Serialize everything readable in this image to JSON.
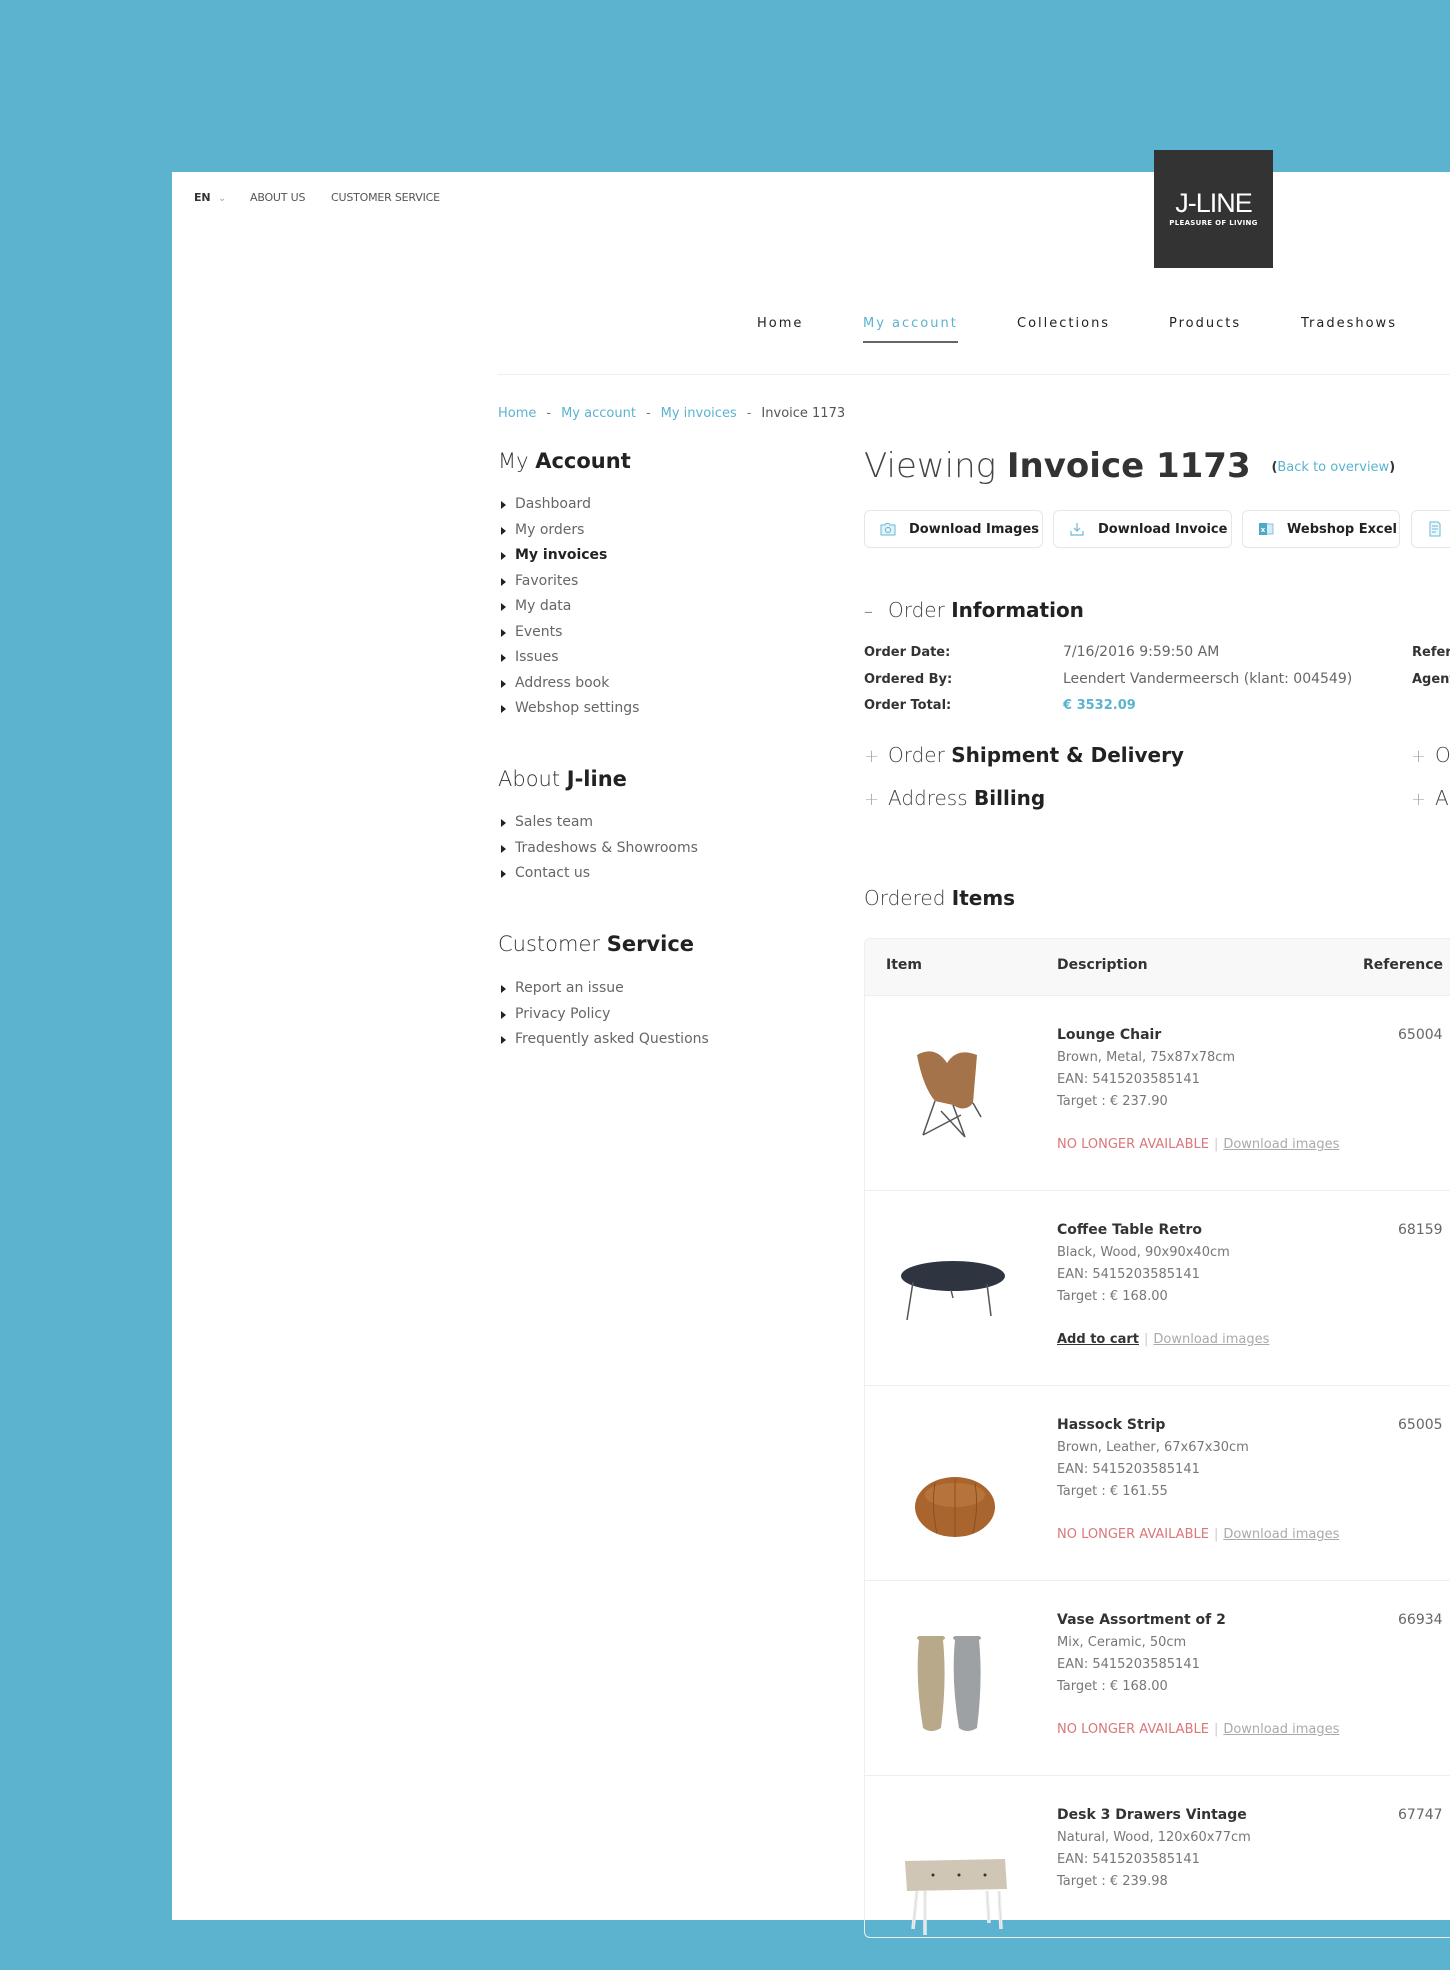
{
  "colors": {
    "accent": "#5bb3d0",
    "unavailable": "#d9777b",
    "logo_bg": "#333333"
  },
  "topbar": {
    "language": "EN",
    "links": [
      "ABOUT US",
      "CUSTOMER SERVICE"
    ]
  },
  "logo": {
    "brand": "J-LINE",
    "tagline": "PLEASURE OF LIVING"
  },
  "nav": {
    "items": [
      {
        "label": "Home"
      },
      {
        "label": "My account",
        "active": true
      },
      {
        "label": "Collections"
      },
      {
        "label": "Products"
      },
      {
        "label": "Tradeshows"
      }
    ]
  },
  "breadcrumb": {
    "items": [
      "Home",
      "My account",
      "My invoices"
    ],
    "current": "Invoice 1173",
    "separator": "-"
  },
  "sidebar": {
    "account": {
      "title_light": "My",
      "title_bold": "Account",
      "items": [
        "Dashboard",
        "My orders",
        "My invoices",
        "Favorites",
        "My data",
        "Events",
        "Issues",
        "Address book",
        "Webshop settings"
      ],
      "active_index": 2
    },
    "about": {
      "title_light": "About",
      "title_bold": "J-line",
      "items": [
        "Sales team",
        "Tradeshows & Showrooms",
        "Contact us"
      ]
    },
    "service": {
      "title_light": "Customer",
      "title_bold": "Service",
      "items": [
        "Report an issue",
        "Privacy Policy",
        "Frequently asked Questions"
      ]
    }
  },
  "page": {
    "title_light": "Viewing",
    "title_bold": "Invoice 1173",
    "back_label": "Back to overview",
    "buttons": [
      {
        "label": "Download Images",
        "icon": "camera-folder-icon"
      },
      {
        "label": "Download Invoice",
        "icon": "download-icon"
      },
      {
        "label": "Webshop Excel",
        "icon": "excel-icon"
      },
      {
        "label": "",
        "icon": "document-icon"
      }
    ]
  },
  "order_info": {
    "title_light": "Order",
    "title_bold": "Information",
    "toggle": "–",
    "rows": [
      {
        "label": "Order Date:",
        "value": "7/16/2016 9:59:50 AM"
      },
      {
        "label": "Ordered By:",
        "value": "Leendert Vandermeersch (klant: 004549)"
      },
      {
        "label": "Order Total:",
        "value": "€ 3532.09"
      }
    ],
    "right_labels": [
      "Refer",
      "Agent"
    ]
  },
  "collapsed_sections": [
    {
      "toggle": "+",
      "title_light": "Order",
      "title_bold": "Shipment & Delivery"
    },
    {
      "toggle": "+",
      "title_light": "Address",
      "title_bold": "Billing"
    }
  ],
  "collapsed_sections_right": [
    {
      "toggle": "+",
      "title_light": "O"
    },
    {
      "toggle": "+",
      "title_light": "A"
    }
  ],
  "ordered_items": {
    "title_light": "Ordered",
    "title_bold": "Items",
    "columns": [
      "Item",
      "Description",
      "Reference"
    ],
    "download_label": "Download images",
    "unavailable_label": "NO LONGER AVAILABLE",
    "add_to_cart_label": "Add to cart",
    "rows": [
      {
        "name": "Lounge Chair",
        "spec": "Brown, Metal, 75x87x78cm",
        "ean": "EAN: 5415203585141",
        "target": "Target : € 237.90",
        "reference": "65004",
        "available": false,
        "image": "lounge-chair"
      },
      {
        "name": "Coffee Table Retro",
        "spec": "Black, Wood, 90x90x40cm",
        "ean": "EAN: 5415203585141",
        "target": "Target : € 168.00",
        "reference": "68159",
        "available": true,
        "image": "coffee-table"
      },
      {
        "name": "Hassock Strip",
        "spec": "Brown, Leather, 67x67x30cm",
        "ean": "EAN: 5415203585141",
        "target": "Target : € 161.55",
        "reference": "65005",
        "available": false,
        "image": "hassock"
      },
      {
        "name": "Vase Assortment of 2",
        "spec": "Mix, Ceramic, 50cm",
        "ean": "EAN: 5415203585141",
        "target": "Target : € 168.00",
        "reference": "66934",
        "available": false,
        "image": "vases"
      },
      {
        "name": "Desk 3 Drawers Vintage",
        "spec": "Natural, Wood, 120x60x77cm",
        "ean": "EAN: 5415203585141",
        "target": "Target : € 239.98",
        "reference": "67747",
        "available": null,
        "image": "desk"
      }
    ]
  }
}
